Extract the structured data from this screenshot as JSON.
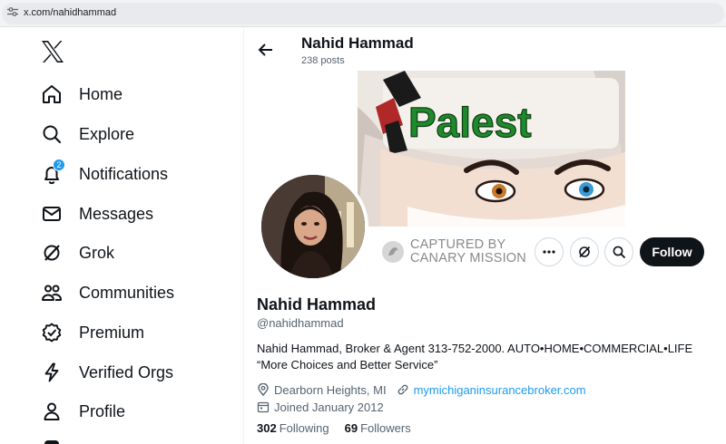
{
  "browser": {
    "url": "x.com/nahidhammad"
  },
  "sidebar": {
    "items": [
      {
        "label": "Home",
        "icon": "home-icon"
      },
      {
        "label": "Explore",
        "icon": "search-icon"
      },
      {
        "label": "Notifications",
        "icon": "bell-icon",
        "badge": "2"
      },
      {
        "label": "Messages",
        "icon": "envelope-icon"
      },
      {
        "label": "Grok",
        "icon": "grok-icon"
      },
      {
        "label": "Communities",
        "icon": "people-icon"
      },
      {
        "label": "Premium",
        "icon": "verified-badge-icon"
      },
      {
        "label": "Verified Orgs",
        "icon": "lightning-icon"
      },
      {
        "label": "Profile",
        "icon": "person-icon"
      }
    ]
  },
  "header": {
    "name": "Nahid Hammad",
    "posts": "238 posts"
  },
  "banner": {
    "text": "Palest"
  },
  "profile": {
    "captured_label_line1": "CAPTURED BY",
    "captured_label_line2": "CANARY MISSION",
    "follow_label": "Follow",
    "name": "Nahid Hammad",
    "handle": "@nahidhammad",
    "bio_line1": "Nahid Hammad, Broker & Agent 313-752-2000. AUTO•HOME•COMMERCIAL•LIFE",
    "bio_line2": "“More Choices and Better Service”",
    "location": "Dearborn Heights, MI",
    "website": "mymichiganinsurancebroker.com",
    "joined": "Joined January 2012",
    "following_count": "302",
    "following_label": "Following",
    "followers_count": "69",
    "followers_label": "Followers"
  },
  "colors": {
    "accent": "#1d9bf0",
    "text": "#0f1419",
    "muted": "#536471",
    "follow_bg": "#0f1419"
  }
}
